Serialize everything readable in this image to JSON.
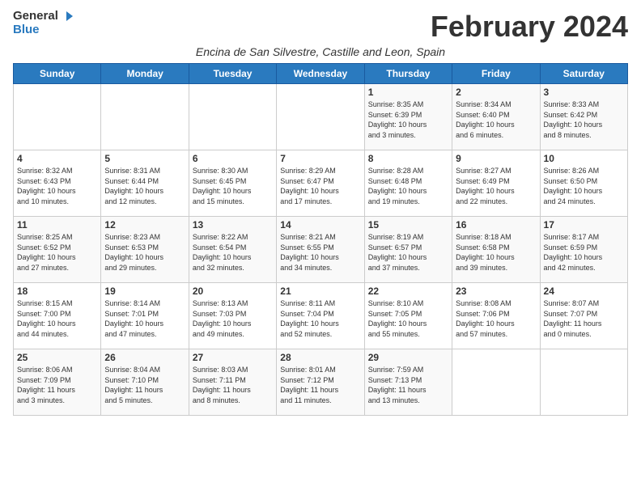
{
  "header": {
    "logo_general": "General",
    "logo_blue": "Blue",
    "month_title": "February 2024",
    "subtitle": "Encina de San Silvestre, Castille and Leon, Spain"
  },
  "weekdays": [
    "Sunday",
    "Monday",
    "Tuesday",
    "Wednesday",
    "Thursday",
    "Friday",
    "Saturday"
  ],
  "weeks": [
    [
      {
        "day": "",
        "info": ""
      },
      {
        "day": "",
        "info": ""
      },
      {
        "day": "",
        "info": ""
      },
      {
        "day": "",
        "info": ""
      },
      {
        "day": "1",
        "info": "Sunrise: 8:35 AM\nSunset: 6:39 PM\nDaylight: 10 hours\nand 3 minutes."
      },
      {
        "day": "2",
        "info": "Sunrise: 8:34 AM\nSunset: 6:40 PM\nDaylight: 10 hours\nand 6 minutes."
      },
      {
        "day": "3",
        "info": "Sunrise: 8:33 AM\nSunset: 6:42 PM\nDaylight: 10 hours\nand 8 minutes."
      }
    ],
    [
      {
        "day": "4",
        "info": "Sunrise: 8:32 AM\nSunset: 6:43 PM\nDaylight: 10 hours\nand 10 minutes."
      },
      {
        "day": "5",
        "info": "Sunrise: 8:31 AM\nSunset: 6:44 PM\nDaylight: 10 hours\nand 12 minutes."
      },
      {
        "day": "6",
        "info": "Sunrise: 8:30 AM\nSunset: 6:45 PM\nDaylight: 10 hours\nand 15 minutes."
      },
      {
        "day": "7",
        "info": "Sunrise: 8:29 AM\nSunset: 6:47 PM\nDaylight: 10 hours\nand 17 minutes."
      },
      {
        "day": "8",
        "info": "Sunrise: 8:28 AM\nSunset: 6:48 PM\nDaylight: 10 hours\nand 19 minutes."
      },
      {
        "day": "9",
        "info": "Sunrise: 8:27 AM\nSunset: 6:49 PM\nDaylight: 10 hours\nand 22 minutes."
      },
      {
        "day": "10",
        "info": "Sunrise: 8:26 AM\nSunset: 6:50 PM\nDaylight: 10 hours\nand 24 minutes."
      }
    ],
    [
      {
        "day": "11",
        "info": "Sunrise: 8:25 AM\nSunset: 6:52 PM\nDaylight: 10 hours\nand 27 minutes."
      },
      {
        "day": "12",
        "info": "Sunrise: 8:23 AM\nSunset: 6:53 PM\nDaylight: 10 hours\nand 29 minutes."
      },
      {
        "day": "13",
        "info": "Sunrise: 8:22 AM\nSunset: 6:54 PM\nDaylight: 10 hours\nand 32 minutes."
      },
      {
        "day": "14",
        "info": "Sunrise: 8:21 AM\nSunset: 6:55 PM\nDaylight: 10 hours\nand 34 minutes."
      },
      {
        "day": "15",
        "info": "Sunrise: 8:19 AM\nSunset: 6:57 PM\nDaylight: 10 hours\nand 37 minutes."
      },
      {
        "day": "16",
        "info": "Sunrise: 8:18 AM\nSunset: 6:58 PM\nDaylight: 10 hours\nand 39 minutes."
      },
      {
        "day": "17",
        "info": "Sunrise: 8:17 AM\nSunset: 6:59 PM\nDaylight: 10 hours\nand 42 minutes."
      }
    ],
    [
      {
        "day": "18",
        "info": "Sunrise: 8:15 AM\nSunset: 7:00 PM\nDaylight: 10 hours\nand 44 minutes."
      },
      {
        "day": "19",
        "info": "Sunrise: 8:14 AM\nSunset: 7:01 PM\nDaylight: 10 hours\nand 47 minutes."
      },
      {
        "day": "20",
        "info": "Sunrise: 8:13 AM\nSunset: 7:03 PM\nDaylight: 10 hours\nand 49 minutes."
      },
      {
        "day": "21",
        "info": "Sunrise: 8:11 AM\nSunset: 7:04 PM\nDaylight: 10 hours\nand 52 minutes."
      },
      {
        "day": "22",
        "info": "Sunrise: 8:10 AM\nSunset: 7:05 PM\nDaylight: 10 hours\nand 55 minutes."
      },
      {
        "day": "23",
        "info": "Sunrise: 8:08 AM\nSunset: 7:06 PM\nDaylight: 10 hours\nand 57 minutes."
      },
      {
        "day": "24",
        "info": "Sunrise: 8:07 AM\nSunset: 7:07 PM\nDaylight: 11 hours\nand 0 minutes."
      }
    ],
    [
      {
        "day": "25",
        "info": "Sunrise: 8:06 AM\nSunset: 7:09 PM\nDaylight: 11 hours\nand 3 minutes."
      },
      {
        "day": "26",
        "info": "Sunrise: 8:04 AM\nSunset: 7:10 PM\nDaylight: 11 hours\nand 5 minutes."
      },
      {
        "day": "27",
        "info": "Sunrise: 8:03 AM\nSunset: 7:11 PM\nDaylight: 11 hours\nand 8 minutes."
      },
      {
        "day": "28",
        "info": "Sunrise: 8:01 AM\nSunset: 7:12 PM\nDaylight: 11 hours\nand 11 minutes."
      },
      {
        "day": "29",
        "info": "Sunrise: 7:59 AM\nSunset: 7:13 PM\nDaylight: 11 hours\nand 13 minutes."
      },
      {
        "day": "",
        "info": ""
      },
      {
        "day": "",
        "info": ""
      }
    ]
  ]
}
